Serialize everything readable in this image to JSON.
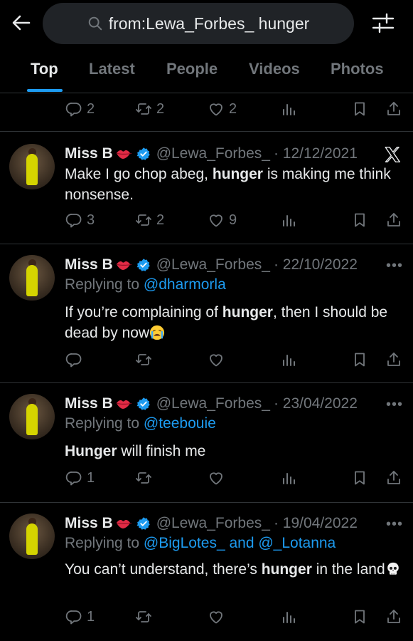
{
  "search": {
    "query": "from:Lewa_Forbes_ hunger"
  },
  "tabs": [
    "Top",
    "Latest",
    "People",
    "Videos",
    "Photos"
  ],
  "top_actions": {
    "replies": "2",
    "reposts": "2",
    "likes": "2"
  },
  "tweets": [
    {
      "name": "Miss B",
      "handle": "@Lewa_Forbes_",
      "date": "· 12/12/2021",
      "reply_prefix": "",
      "reply_to": "",
      "text_before": "Make I go chop abeg, ",
      "text_bold": "hunger",
      "text_after": " is making me think nonsense.",
      "replies": "3",
      "reposts": "2",
      "likes": "9"
    },
    {
      "name": "Miss B",
      "handle": "@Lewa_Forbes_",
      "date": "· 22/10/2022",
      "reply_prefix": "Replying to ",
      "reply_to": "@dharmorla",
      "text_before": "If you’re complaining of ",
      "text_bold": "hunger",
      "text_after": ", then I should be dead by now",
      "replies": "",
      "reposts": "",
      "likes": ""
    },
    {
      "name": "Miss B",
      "handle": "@Lewa_Forbes_",
      "date": "· 23/04/2022",
      "reply_prefix": "Replying to ",
      "reply_to": "@teebouie",
      "text_before": "",
      "text_bold": "Hunger",
      "text_after": " will finish me",
      "replies": "1",
      "reposts": "",
      "likes": ""
    },
    {
      "name": "Miss B",
      "handle": "@Lewa_Forbes_",
      "date": "· 19/04/2022",
      "reply_prefix": "Replying to ",
      "reply_to": "@BigLotes_ and @_Lotanna",
      "text_before": "You can’t understand, there’s ",
      "text_bold": "hunger",
      "text_after": " in the land",
      "replies": "1",
      "reposts": "",
      "likes": ""
    }
  ],
  "colors": {
    "accent": "#1d9bf0",
    "muted": "#71767b",
    "text": "#e7e9ea",
    "background": "#000000"
  },
  "icons": [
    "back-arrow-icon",
    "search-icon",
    "filter-icon",
    "reply-icon",
    "repost-icon",
    "like-icon",
    "views-icon",
    "bookmark-icon",
    "share-icon",
    "verified-icon",
    "x-logo-icon",
    "more-icon",
    "lips-emoji",
    "crying-emoji",
    "skull-emoji"
  ]
}
